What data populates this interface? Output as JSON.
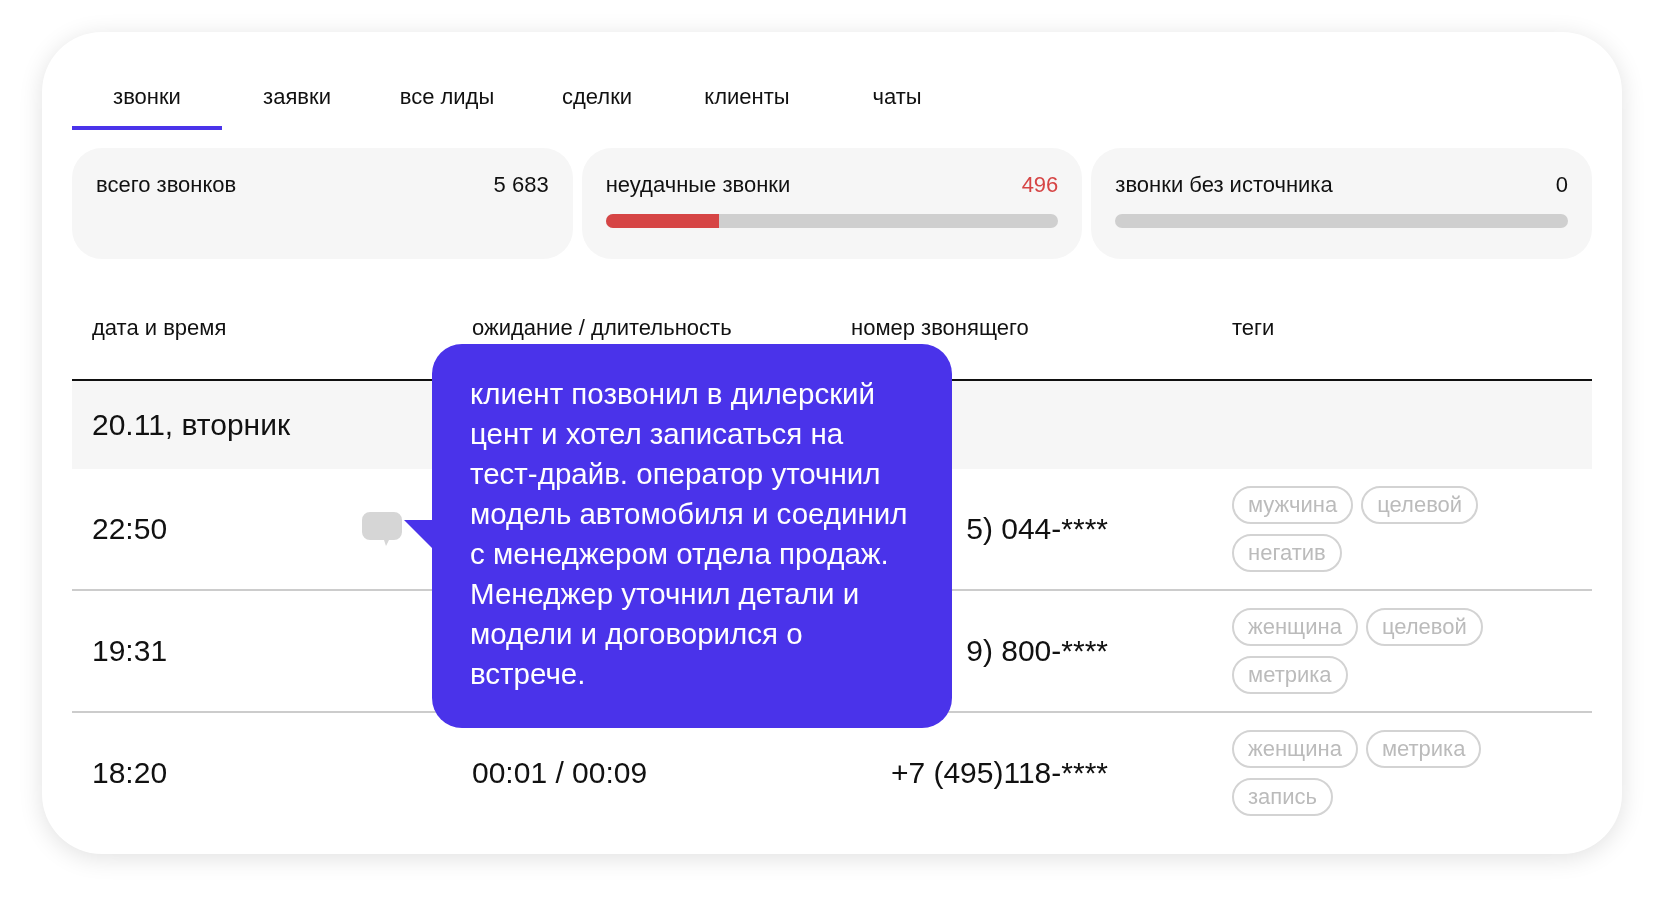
{
  "tabs": [
    {
      "label": "звонки",
      "selected": true
    },
    {
      "label": "заявки",
      "selected": false
    },
    {
      "label": "все лиды",
      "selected": false
    },
    {
      "label": "сделки",
      "selected": false
    },
    {
      "label": "клиенты",
      "selected": false
    },
    {
      "label": "чаты",
      "selected": false
    }
  ],
  "stats": [
    {
      "label": "всего звонков",
      "value": "5 683",
      "kind": "plain"
    },
    {
      "label": "неудачные звонки",
      "value": "496",
      "kind": "bar",
      "alert": true,
      "level": 0.25
    },
    {
      "label": "звонки без источника",
      "value": "0",
      "kind": "bar",
      "alert": false,
      "level": 0
    }
  ],
  "table": {
    "columns": [
      "дата и время",
      "ожидание / длительность",
      "номер звонящего",
      "теги"
    ],
    "groups": [
      {
        "label": "20.11, вторник",
        "rows": [
          {
            "time": "22:50",
            "comment": true,
            "phone": "5) 044-****",
            "tags": [
              "мужчина",
              "целевой",
              "негатив"
            ]
          },
          {
            "time": "19:31",
            "comment": false,
            "phone": "9) 800-****",
            "tags": [
              "женщина",
              "целевой",
              "метрика"
            ]
          },
          {
            "time": "18:20",
            "comment": false,
            "wait": "00:01 / 00:09",
            "phone": "+7 (495)118-****",
            "tags": [
              "женщина",
              "метрика",
              "запись"
            ]
          }
        ]
      }
    ]
  },
  "tooltip": {
    "text": "клиент позвонил в дилерский цент и хотел записаться на тест-драйв. оператор уточнил модель автомобиля и соединил с менеджером отдела продаж. Менеджер уточнил детали и модели и договорился о встрече."
  }
}
